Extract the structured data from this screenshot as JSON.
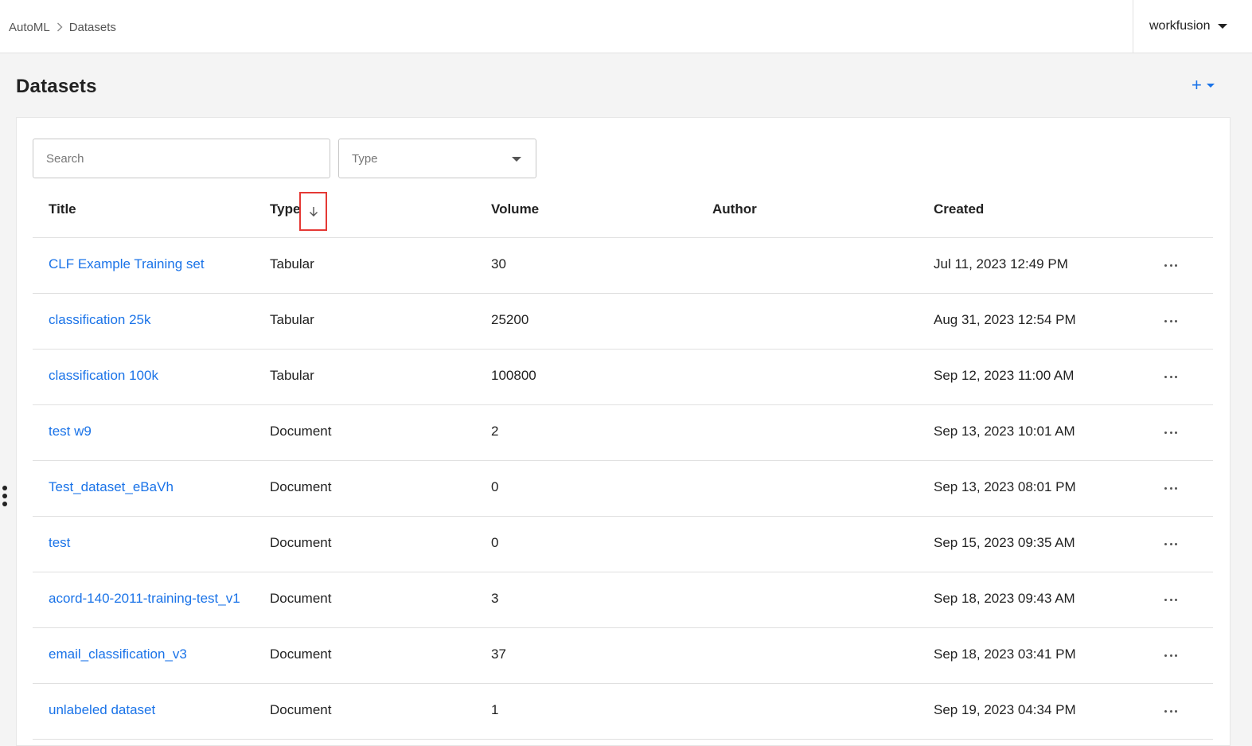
{
  "breadcrumb": {
    "root": "AutoML",
    "current": "Datasets"
  },
  "user": {
    "name": "workfusion"
  },
  "page": {
    "title": "Datasets",
    "add_label": "+"
  },
  "filters": {
    "search_placeholder": "Search",
    "type_placeholder": "Type"
  },
  "table": {
    "headers": {
      "title": "Title",
      "type": "Type",
      "volume": "Volume",
      "author": "Author",
      "created": "Created"
    },
    "sort": {
      "column": "Type",
      "direction": "descending"
    },
    "rows": [
      {
        "title": "CLF Example Training set",
        "type": "Tabular",
        "volume": "30",
        "author": "",
        "created": "Jul 11, 2023 12:49 PM"
      },
      {
        "title": "classification 25k",
        "type": "Tabular",
        "volume": "25200",
        "author": "",
        "created": "Aug 31, 2023 12:54 PM"
      },
      {
        "title": "classification 100k",
        "type": "Tabular",
        "volume": "100800",
        "author": "",
        "created": "Sep 12, 2023 11:00 AM"
      },
      {
        "title": "test w9",
        "type": "Document",
        "volume": "2",
        "author": "",
        "created": "Sep 13, 2023 10:01 AM"
      },
      {
        "title": "Test_dataset_eBaVh",
        "type": "Document",
        "volume": "0",
        "author": "",
        "created": "Sep 13, 2023 08:01 PM"
      },
      {
        "title": "test",
        "type": "Document",
        "volume": "0",
        "author": "",
        "created": "Sep 15, 2023 09:35 AM"
      },
      {
        "title": "acord-140-2011-training-test_v1",
        "type": "Document",
        "volume": "3",
        "author": "",
        "created": "Sep 18, 2023 09:43 AM"
      },
      {
        "title": "email_classification_v3",
        "type": "Document",
        "volume": "37",
        "author": "",
        "created": "Sep 18, 2023 03:41 PM"
      },
      {
        "title": "unlabeled dataset",
        "type": "Document",
        "volume": "1",
        "author": "",
        "created": "Sep 19, 2023 04:34 PM"
      }
    ]
  },
  "colors": {
    "link": "#1a73e8",
    "sort_highlight": "#e53935"
  }
}
